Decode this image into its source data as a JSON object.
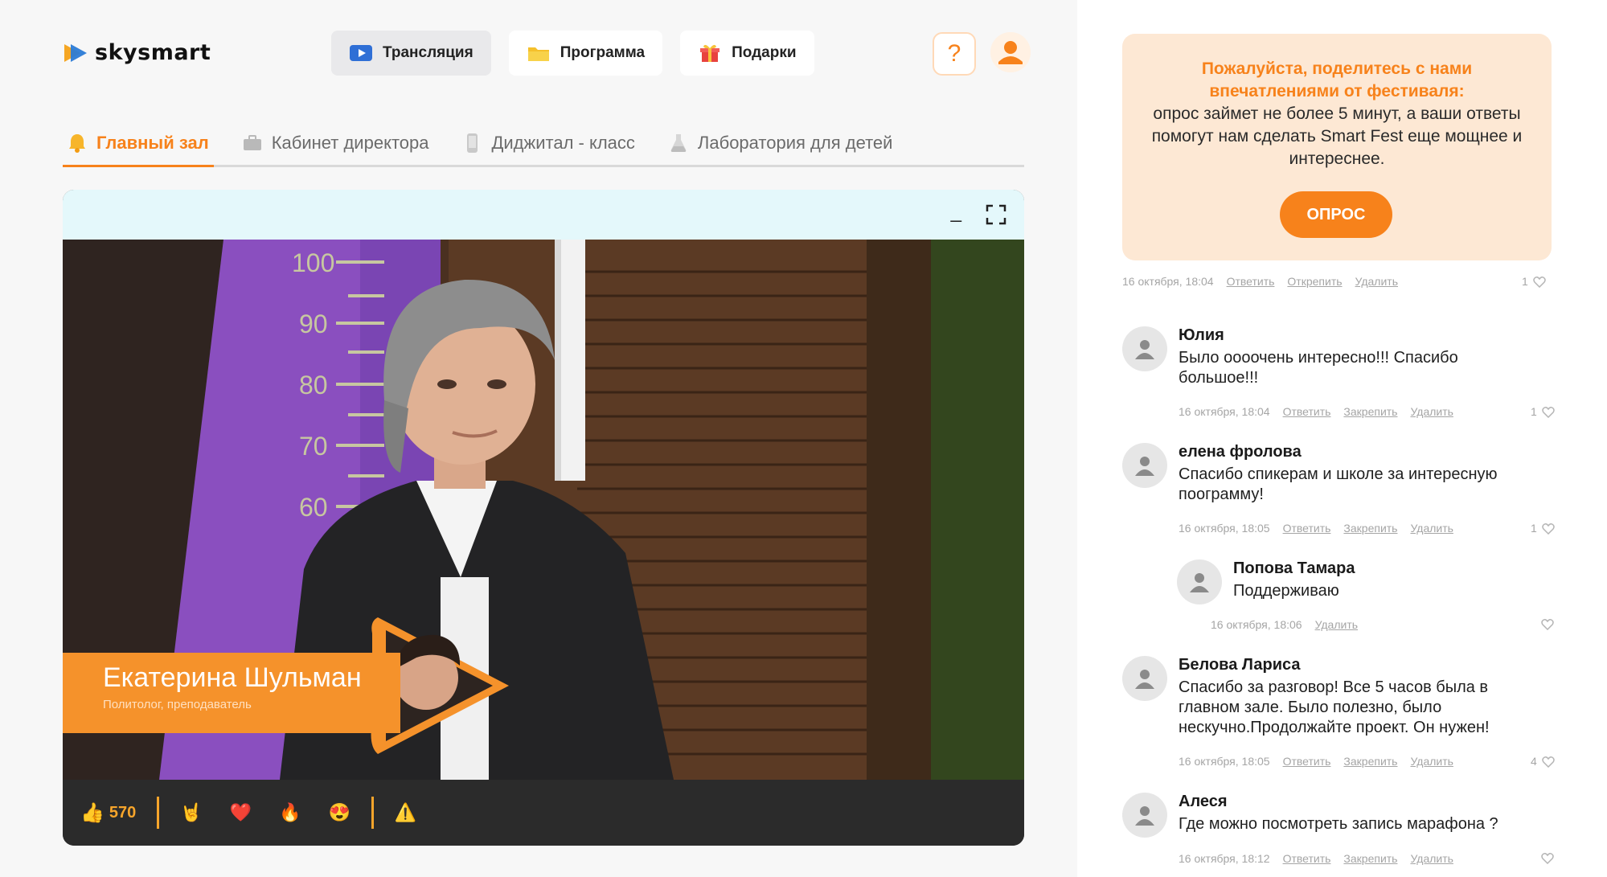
{
  "brand": {
    "name": "skysmart"
  },
  "topnav": [
    {
      "label": "Трансляция",
      "icon": "play-icon",
      "active": true
    },
    {
      "label": "Программа",
      "icon": "folder-icon",
      "active": false
    },
    {
      "label": "Подарки",
      "icon": "gift-icon",
      "active": false
    }
  ],
  "header": {
    "help_label": "?"
  },
  "halls": [
    {
      "label": "Главный зал",
      "icon": "bell-icon",
      "active": true
    },
    {
      "label": "Кабинет директора",
      "icon": "briefcase-icon",
      "active": false
    },
    {
      "label": "Диджитал - класс",
      "icon": "phone-icon",
      "active": false
    },
    {
      "label": "Лаборатория для детей",
      "icon": "flask-icon",
      "active": false
    }
  ],
  "player": {
    "minimize_label": "_",
    "scale_marks": [
      "100",
      "90",
      "80",
      "70",
      "60"
    ],
    "speaker_name": "Екатерина Шульман",
    "speaker_title": "Политолог, преподаватель",
    "likes_count": "570",
    "reactions": [
      "🤘",
      "❤️",
      "🔥",
      "😍"
    ],
    "warning_icon": "⚠️",
    "accent_color": "#f5922b"
  },
  "poll": {
    "title": "Пожалуйста, поделитесь с нами впечатлениями от фестиваля:",
    "text": "опрос займет не более 5 минут, а ваши ответы помогут нам сделать Smart Fest еще мощнее и интереснее.",
    "button": "ОПРОС",
    "date": "16 октября, 18:04",
    "reply": "Ответить",
    "unpin": "Открепить",
    "delete": "Удалить",
    "likes": "1"
  },
  "comments": [
    {
      "name": "Юлия",
      "text": "Было оооочень интересно!!! Спасибо большое!!!",
      "date": "16 октября, 18:04",
      "reply": "Ответить",
      "pin": "Закрепить",
      "delete": "Удалить",
      "likes": "1"
    },
    {
      "name": "елена фролова",
      "text": "Спасибо спикерам и школе за интересную поограмму!",
      "date": "16 октября, 18:05",
      "reply": "Ответить",
      "pin": "Закрепить",
      "delete": "Удалить",
      "likes": "1"
    },
    {
      "name": "Попова Тамара",
      "text": "Поддерживаю",
      "date": "16 октября, 18:06",
      "delete": "Удалить"
    },
    {
      "name": "Белова Лариса",
      "text": "Спасибо за разговор! Все 5 часов  была в главном зале. Было полезно, было нескучно.Продолжайте проект. Он нужен!",
      "date": "16 октября, 18:05",
      "reply": "Ответить",
      "pin": "Закрепить",
      "delete": "Удалить",
      "likes": "4"
    },
    {
      "name": "Алеся",
      "text": "Где можно посмотреть запись марафона ?",
      "date": "16 октября, 18:12",
      "reply": "Ответить",
      "pin": "Закрепить",
      "delete": "Удалить"
    }
  ]
}
